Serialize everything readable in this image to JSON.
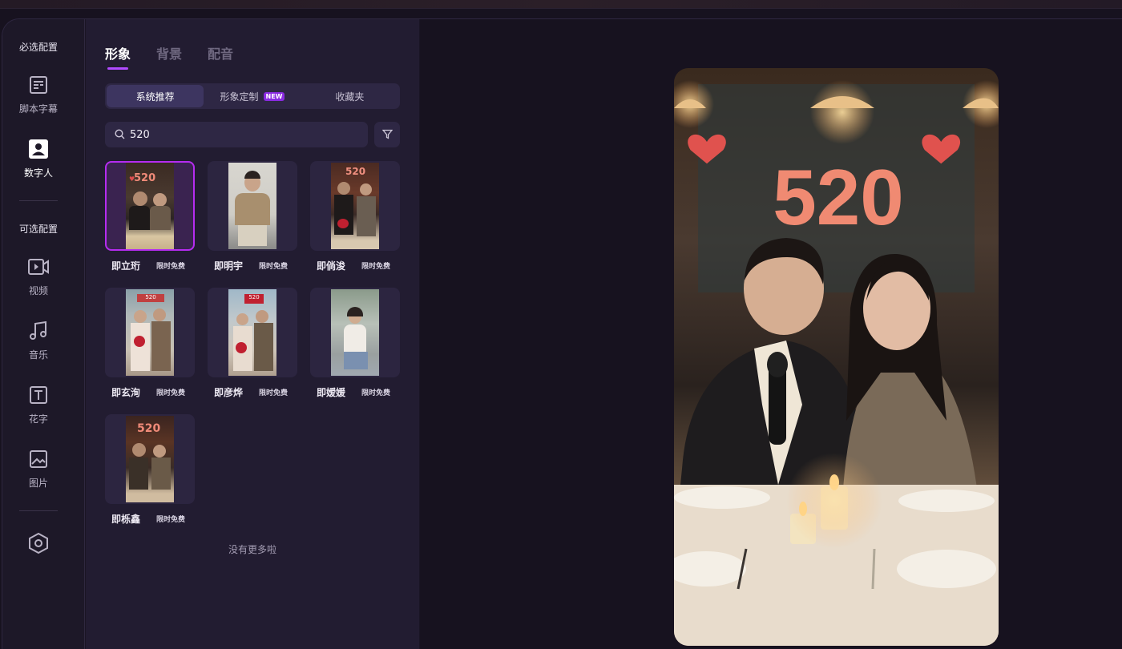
{
  "rail": {
    "required_title": "必选配置",
    "optional_title": "可选配置",
    "items": [
      {
        "label": "脚本字幕",
        "icon": "script-icon"
      },
      {
        "label": "数字人",
        "icon": "digital-human-icon"
      },
      {
        "label": "视频",
        "icon": "video-icon"
      },
      {
        "label": "音乐",
        "icon": "music-icon"
      },
      {
        "label": "花字",
        "icon": "text-style-icon"
      },
      {
        "label": "图片",
        "icon": "image-icon"
      }
    ]
  },
  "panel": {
    "tabs": [
      "形象",
      "背景",
      "配音"
    ],
    "segments": [
      "系统推荐",
      "形象定制",
      "收藏夹"
    ],
    "new_badge": "NEW",
    "search": {
      "value": "520",
      "placeholder": ""
    },
    "cards": [
      {
        "name": "即立珩",
        "tag": "限时免费"
      },
      {
        "name": "即明宇",
        "tag": "限时免费"
      },
      {
        "name": "即倘浚",
        "tag": "限时免费"
      },
      {
        "name": "即玄洵",
        "tag": "限时免费"
      },
      {
        "name": "即彦烨",
        "tag": "限时免费"
      },
      {
        "name": "即嫒媛",
        "tag": "限时免费"
      },
      {
        "name": "即栎鑫",
        "tag": "限时免费"
      }
    ],
    "no_more": "没有更多啦"
  },
  "preview": {
    "sign_text": "520"
  },
  "colors": {
    "accent": "#b14bff",
    "selected_border": "#b52cf0",
    "badge": "#8a2be2"
  }
}
